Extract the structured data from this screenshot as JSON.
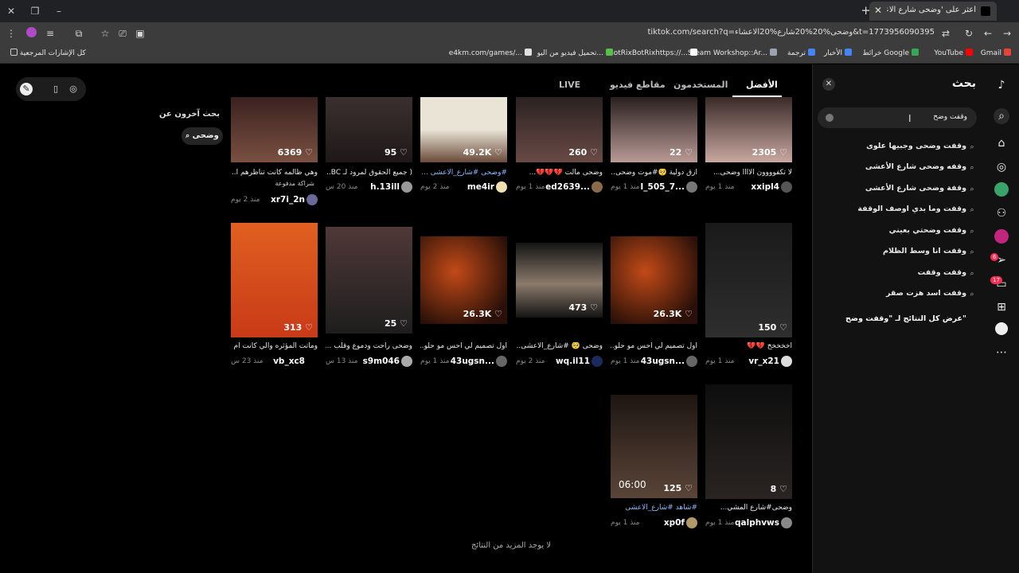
{
  "browser": {
    "tab_title": "اعثر على 'وضحى شارع الاعشاء' ...",
    "url": "tiktok.com/search?q=وضحى%20%20شارع%20الاعشاء&t=1773956090395",
    "bookmarks": [
      {
        "label": "Gmail",
        "color": "#ea4335"
      },
      {
        "label": "YouTube",
        "color": "#ff0000"
      },
      {
        "label": "خرائط Google",
        "color": "#34a853"
      },
      {
        "label": "الأخبار",
        "color": "#4285f4"
      },
      {
        "label": "ترجمة",
        "color": "#4285f4"
      },
      {
        "label": "Steam Workshop::Ar...",
        "color": "#1b2838"
      },
      {
        "label": "BotRixBotRixhttps://...",
        "color": "#ffffff"
      },
      {
        "label": "تحميل فيديو من اليو...",
        "color": "#56c04a"
      },
      {
        "label": "e4km.com/games/...",
        "color": "#888888"
      },
      {
        "label": "كل الإشارات المرجعية",
        "color": "#888888"
      }
    ]
  },
  "tabs": {
    "top": "الأفضل",
    "users": "المستخدمون",
    "videos": "مقاطع فيديو",
    "live": "LIVE"
  },
  "others": {
    "title": "بحث آخرون عن",
    "chip": "وضحى"
  },
  "videos": [
    {
      "likes": "2305",
      "caption": "لا تكفوووون الاااا وضحى...",
      "author": "xxipl4",
      "time": "منذ 1 يوم",
      "colors": [
        "#3a2a28",
        "#c9a7a0"
      ]
    },
    {
      "likes": "22",
      "caption": "ازق دولية 🥺#موت وضحى...",
      "author": "I_505_7...",
      "time": "منذ 1 يوم",
      "colors": [
        "#2a2020",
        "#b99a94"
      ]
    },
    {
      "likes": "260",
      "caption": "وضحى مالت 💔💔💔...",
      "author": "ed2639...",
      "time": "منذ 1 يوم",
      "colors": [
        "#2a2222",
        "#6a4a44"
      ]
    },
    {
      "likes": "49.2K",
      "caption": "#وضحى #شارع_الاعشى ...",
      "author": "me4ir",
      "time": "منذ 2 يوم",
      "colors": [
        "#e9e4d6",
        "#6b4b3a"
      ]
    },
    {
      "likes": "95",
      "caption": "( جميع الحقوق لمرود لـ BC...",
      "author": "h.13ill",
      "time": "منذ 20 س",
      "colors": [
        "#3a3030",
        "#201818"
      ]
    },
    {
      "likes": "6369",
      "caption": "وهي ظالمه كانت تناظرهم ا...",
      "author": "xr7i_2n",
      "time": "منذ 2 يوم",
      "sponsor": "شراكة مدفوعة",
      "colors": [
        "#3a2220",
        "#7a5040"
      ]
    },
    {
      "likes": "150",
      "caption": "اخخخخخ 💔💔",
      "author": "vr_x21",
      "time": "منذ 1 يوم",
      "colors": [
        "#1a1a1a",
        "#2e2e2e"
      ]
    },
    {
      "likes": "26.3K",
      "caption": "اول تصميم لي احس مو حلو...",
      "author": "43ugsn...",
      "time": "منذ 1 يوم",
      "colors": [
        "#2a1008",
        "#c24a18"
      ]
    },
    {
      "likes": "473",
      "caption": "وضحى 🥺 #شارع_الاعشى...",
      "author": "wq.il11",
      "time": "منذ 2 يوم",
      "colors": [
        "#141414",
        "#8a7a6a"
      ]
    },
    {
      "likes": "26.3K",
      "caption": "اول تصميم لي احس مو حلو...",
      "author": "43ugsn...",
      "time": "منذ 1 يوم",
      "colors": [
        "#2a1008",
        "#c24a18"
      ]
    },
    {
      "likes": "25",
      "caption": "وضحى راحت ودموع وقلب ...",
      "author": "s9m046",
      "time": "منذ 13 س",
      "colors": [
        "#1e1e1e",
        "#503838"
      ]
    },
    {
      "likes": "313",
      "caption": "وماتت المؤثره والي كانت ام ...",
      "author": "vb_xc8",
      "time": "منذ 23 س",
      "colors": [
        "#e06020",
        "#c83a18"
      ]
    },
    {
      "likes": "8",
      "caption": "وضحى#شارع المشي...",
      "author": "qalphvws",
      "time": "منذ 1 يوم",
      "colors": [
        "#0e0e0e",
        "#2a2422"
      ]
    },
    {
      "likes": "125",
      "caption": "#شاهد #شارع_الاعشى",
      "author": "xp0f",
      "time": "منذ 1 يوم",
      "duration": "06:00",
      "colors": [
        "#1e1612",
        "#5a4438"
      ]
    }
  ],
  "no_more": "لا يوجد المزيد من النتائج",
  "search_panel": {
    "title": "بحث",
    "input_value": "وقفت وضح",
    "suggestions": [
      "وقفت وضحى وجبيها علوى",
      "وقفه وضحى شارع الأعشى",
      "وقفة وضحى شارع الأعشى",
      "وقفت وما بدي اوصف الوقفة",
      "وقفت وضحتي بعيني",
      "وقفت انا وسط الظلام",
      "وقفت وقفت",
      "وقفت اسد هزت صقر"
    ],
    "see_all": "عرض كل النتائج لـ \"وقفت وضح\""
  },
  "rail": {
    "badge_inbox": "6",
    "badge_messages": "17"
  }
}
